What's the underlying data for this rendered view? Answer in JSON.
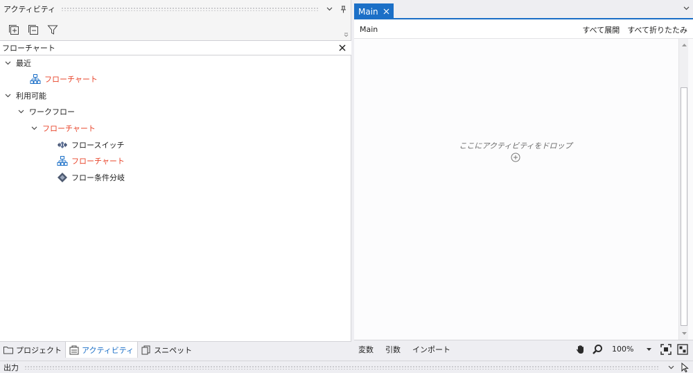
{
  "activities_panel": {
    "title": "アクティビティ",
    "search": {
      "value": "フローチャート",
      "placeholder": ""
    },
    "tree": {
      "recent": {
        "label": "最近",
        "items": [
          {
            "label": "フローチャート"
          }
        ]
      },
      "available": {
        "label": "利用可能",
        "workflow": {
          "label": "ワークフロー",
          "flowchart": {
            "label": "フローチャート",
            "items": [
              {
                "label": "フロースイッチ",
                "icon": "flow-switch-icon"
              },
              {
                "label": "フローチャート",
                "icon": "flowchart-icon"
              },
              {
                "label": "フロー条件分岐",
                "icon": "flow-decision-icon"
              }
            ]
          }
        }
      }
    },
    "bottom_tabs": [
      {
        "label": "プロジェクト",
        "icon": "folder-icon"
      },
      {
        "label": "アクティビティ",
        "icon": "activities-icon"
      },
      {
        "label": "スニペット",
        "icon": "snippets-icon"
      }
    ]
  },
  "designer": {
    "tab": {
      "label": "Main"
    },
    "breadcrumb": "Main",
    "expand_all": "すべて展開",
    "collapse_all": "すべて折りたたみ",
    "drop_hint": "ここにアクティビティをドロップ",
    "footer_tabs": [
      "変数",
      "引数",
      "インポート"
    ],
    "zoom": "100%"
  },
  "output": {
    "title": "出力"
  },
  "colors": {
    "accent": "#1b6fc7",
    "highlight": "#e8442a"
  }
}
